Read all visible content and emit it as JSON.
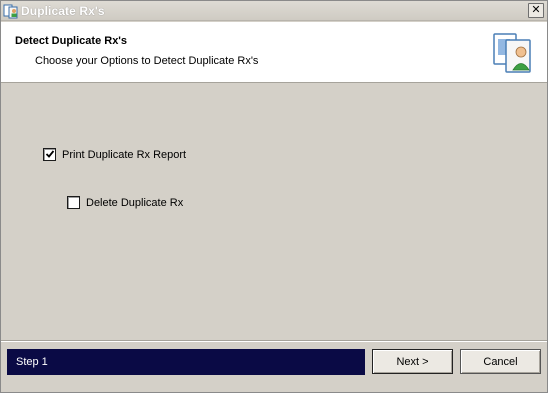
{
  "window": {
    "title": "Duplicate Rx's",
    "close_label": "✕"
  },
  "header": {
    "title": "Detect Duplicate Rx's",
    "subtitle": "Choose your Options to Detect Duplicate Rx's",
    "icon": "documents-user-icon"
  },
  "options": [
    {
      "label": "Print Duplicate Rx Report",
      "checked": true
    },
    {
      "label": "Delete Duplicate Rx",
      "checked": false
    }
  ],
  "footer": {
    "step_label": "Step 1",
    "next_label": "Next >",
    "cancel_label": "Cancel"
  },
  "colors": {
    "step_bar": "#0a0a45",
    "dialog_bg": "#d4d0c8"
  }
}
